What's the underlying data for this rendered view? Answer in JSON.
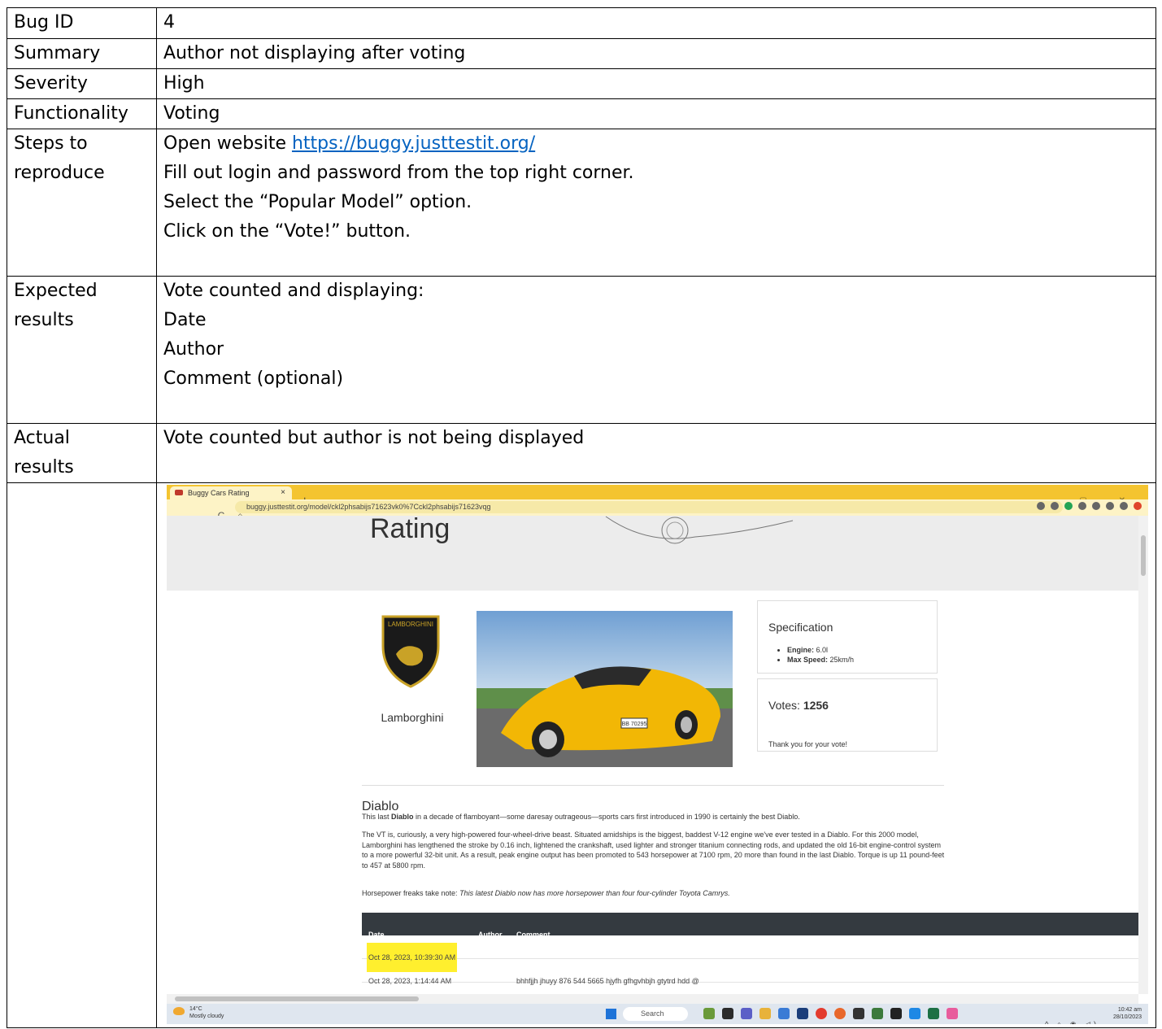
{
  "report": {
    "bug_id": {
      "label": "Bug ID",
      "value": "4"
    },
    "summary": {
      "label": "Summary",
      "value": "Author not displaying after voting"
    },
    "severity": {
      "label": "Severity",
      "value": "High"
    },
    "functionality": {
      "label": "Functionality",
      "value": "Voting"
    },
    "steps": {
      "label_line1": "Steps to",
      "label_line2": "reproduce",
      "step1_text": "Open website ",
      "step1_link": "https://buggy.justtestit.org/",
      "step2": "Fill out login and password from the top right corner.",
      "step3": "Select the “Popular Model” option.",
      "step4": "Click on the “Vote!” button."
    },
    "expected": {
      "label_line1": "Expected",
      "label_line2": "results",
      "line1": "Vote counted and displaying:",
      "line2": "Date",
      "line3": "Author",
      "line4": "Comment (optional)"
    },
    "actual": {
      "label_line1": "Actual",
      "label_line2": "results",
      "value": "Vote counted but author is not being displayed"
    }
  },
  "screenshot": {
    "tab_title": "Buggy Cars Rating",
    "tab_close": "×",
    "new_tab": "+",
    "window_controls": "⌄ – ▢ ✕",
    "nav_buttons": "← → C ⌂",
    "url": "buggy.justtestit.org/model/ckl2phsabijs71623vk0%7Cckl2phsabijs71623vqg",
    "banner_title": "Rating",
    "brand_name": "Lamborghini",
    "brand_logo_text": "LAMBORGHINI",
    "spec_title": "Specification",
    "spec_engine_label": "Engine:",
    "spec_engine_value": "6.0l",
    "spec_speed_label": "Max Speed:",
    "spec_speed_value": "25km/h",
    "votes_label": "Votes:",
    "votes_count": "1256",
    "vote_thanks": "Thank you for your vote!",
    "plate_text": "BB 70295",
    "model_name": "Diablo",
    "para1_a": "This last ",
    "para1_b": "Diablo",
    "para1_c": " in a decade of flamboyant—some daresay outrageous—sports cars first introduced in 1990 is certainly the best Diablo.",
    "para2": "The VT is, curiously, a very high-powered four-wheel-drive beast. Situated amidships is the biggest, baddest V-12 engine we've ever tested in a Diablo. For this 2000 model, Lamborghini has lengthened the stroke by 0.16 inch, lightened the crankshaft, used lighter and stronger titanium connecting rods, and updated the old 16-bit engine-control system to a more powerful 32-bit unit. As a result, peak engine output has been promoted to 543 horsepower at 7100 rpm, 20 more than found in the last Diablo. Torque is up 11 pound-feet to 457 at 5800 rpm.",
    "para3_a": "Horsepower freaks take note: ",
    "para3_b": "This latest Diablo now has more horsepower than four four-cylinder Toyota Camrys.",
    "table_headers": {
      "date": "Date",
      "author": "Author",
      "comment": "Comment"
    },
    "rows": [
      {
        "date": "Oct 28, 2023, 10:39:30 AM",
        "author": "",
        "comment": ""
      },
      {
        "date": "Oct 28, 2023, 1:14:44 AM",
        "author": "",
        "comment": "bhhfjjh jhuyy 876 544 5665 hjyfh gfhgvhbjh gtytrd hdd @"
      }
    ],
    "taskbar": {
      "temp": "14°C",
      "weather": "Mostly cloudy",
      "search": "Search",
      "time": "10:42 am",
      "date": "28/10/2023",
      "tray": "^ ⌂ ◉ ◁)"
    },
    "colors": {
      "highlight": "#ffef2e",
      "tabbar": "#f4c430",
      "table_header": "#343a40",
      "car": "#f2b705"
    }
  }
}
